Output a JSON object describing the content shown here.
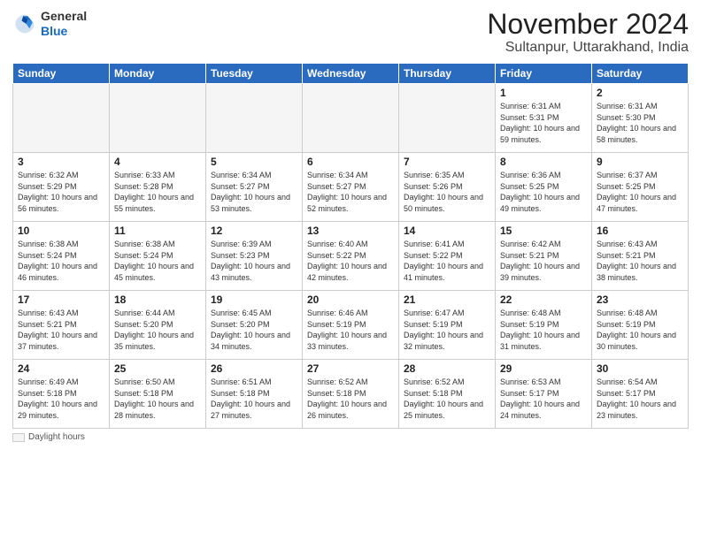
{
  "logo": {
    "general": "General",
    "blue": "Blue"
  },
  "header": {
    "month": "November 2024",
    "location": "Sultanpur, Uttarakhand, India"
  },
  "days_of_week": [
    "Sunday",
    "Monday",
    "Tuesday",
    "Wednesday",
    "Thursday",
    "Friday",
    "Saturday"
  ],
  "footer": {
    "legend_label": "Daylight hours"
  },
  "weeks": [
    [
      {
        "day": "",
        "info": ""
      },
      {
        "day": "",
        "info": ""
      },
      {
        "day": "",
        "info": ""
      },
      {
        "day": "",
        "info": ""
      },
      {
        "day": "",
        "info": ""
      },
      {
        "day": "1",
        "info": "Sunrise: 6:31 AM\nSunset: 5:31 PM\nDaylight: 10 hours and 59 minutes."
      },
      {
        "day": "2",
        "info": "Sunrise: 6:31 AM\nSunset: 5:30 PM\nDaylight: 10 hours and 58 minutes."
      }
    ],
    [
      {
        "day": "3",
        "info": "Sunrise: 6:32 AM\nSunset: 5:29 PM\nDaylight: 10 hours and 56 minutes."
      },
      {
        "day": "4",
        "info": "Sunrise: 6:33 AM\nSunset: 5:28 PM\nDaylight: 10 hours and 55 minutes."
      },
      {
        "day": "5",
        "info": "Sunrise: 6:34 AM\nSunset: 5:27 PM\nDaylight: 10 hours and 53 minutes."
      },
      {
        "day": "6",
        "info": "Sunrise: 6:34 AM\nSunset: 5:27 PM\nDaylight: 10 hours and 52 minutes."
      },
      {
        "day": "7",
        "info": "Sunrise: 6:35 AM\nSunset: 5:26 PM\nDaylight: 10 hours and 50 minutes."
      },
      {
        "day": "8",
        "info": "Sunrise: 6:36 AM\nSunset: 5:25 PM\nDaylight: 10 hours and 49 minutes."
      },
      {
        "day": "9",
        "info": "Sunrise: 6:37 AM\nSunset: 5:25 PM\nDaylight: 10 hours and 47 minutes."
      }
    ],
    [
      {
        "day": "10",
        "info": "Sunrise: 6:38 AM\nSunset: 5:24 PM\nDaylight: 10 hours and 46 minutes."
      },
      {
        "day": "11",
        "info": "Sunrise: 6:38 AM\nSunset: 5:24 PM\nDaylight: 10 hours and 45 minutes."
      },
      {
        "day": "12",
        "info": "Sunrise: 6:39 AM\nSunset: 5:23 PM\nDaylight: 10 hours and 43 minutes."
      },
      {
        "day": "13",
        "info": "Sunrise: 6:40 AM\nSunset: 5:22 PM\nDaylight: 10 hours and 42 minutes."
      },
      {
        "day": "14",
        "info": "Sunrise: 6:41 AM\nSunset: 5:22 PM\nDaylight: 10 hours and 41 minutes."
      },
      {
        "day": "15",
        "info": "Sunrise: 6:42 AM\nSunset: 5:21 PM\nDaylight: 10 hours and 39 minutes."
      },
      {
        "day": "16",
        "info": "Sunrise: 6:43 AM\nSunset: 5:21 PM\nDaylight: 10 hours and 38 minutes."
      }
    ],
    [
      {
        "day": "17",
        "info": "Sunrise: 6:43 AM\nSunset: 5:21 PM\nDaylight: 10 hours and 37 minutes."
      },
      {
        "day": "18",
        "info": "Sunrise: 6:44 AM\nSunset: 5:20 PM\nDaylight: 10 hours and 35 minutes."
      },
      {
        "day": "19",
        "info": "Sunrise: 6:45 AM\nSunset: 5:20 PM\nDaylight: 10 hours and 34 minutes."
      },
      {
        "day": "20",
        "info": "Sunrise: 6:46 AM\nSunset: 5:19 PM\nDaylight: 10 hours and 33 minutes."
      },
      {
        "day": "21",
        "info": "Sunrise: 6:47 AM\nSunset: 5:19 PM\nDaylight: 10 hours and 32 minutes."
      },
      {
        "day": "22",
        "info": "Sunrise: 6:48 AM\nSunset: 5:19 PM\nDaylight: 10 hours and 31 minutes."
      },
      {
        "day": "23",
        "info": "Sunrise: 6:48 AM\nSunset: 5:19 PM\nDaylight: 10 hours and 30 minutes."
      }
    ],
    [
      {
        "day": "24",
        "info": "Sunrise: 6:49 AM\nSunset: 5:18 PM\nDaylight: 10 hours and 29 minutes."
      },
      {
        "day": "25",
        "info": "Sunrise: 6:50 AM\nSunset: 5:18 PM\nDaylight: 10 hours and 28 minutes."
      },
      {
        "day": "26",
        "info": "Sunrise: 6:51 AM\nSunset: 5:18 PM\nDaylight: 10 hours and 27 minutes."
      },
      {
        "day": "27",
        "info": "Sunrise: 6:52 AM\nSunset: 5:18 PM\nDaylight: 10 hours and 26 minutes."
      },
      {
        "day": "28",
        "info": "Sunrise: 6:52 AM\nSunset: 5:18 PM\nDaylight: 10 hours and 25 minutes."
      },
      {
        "day": "29",
        "info": "Sunrise: 6:53 AM\nSunset: 5:17 PM\nDaylight: 10 hours and 24 minutes."
      },
      {
        "day": "30",
        "info": "Sunrise: 6:54 AM\nSunset: 5:17 PM\nDaylight: 10 hours and 23 minutes."
      }
    ]
  ]
}
